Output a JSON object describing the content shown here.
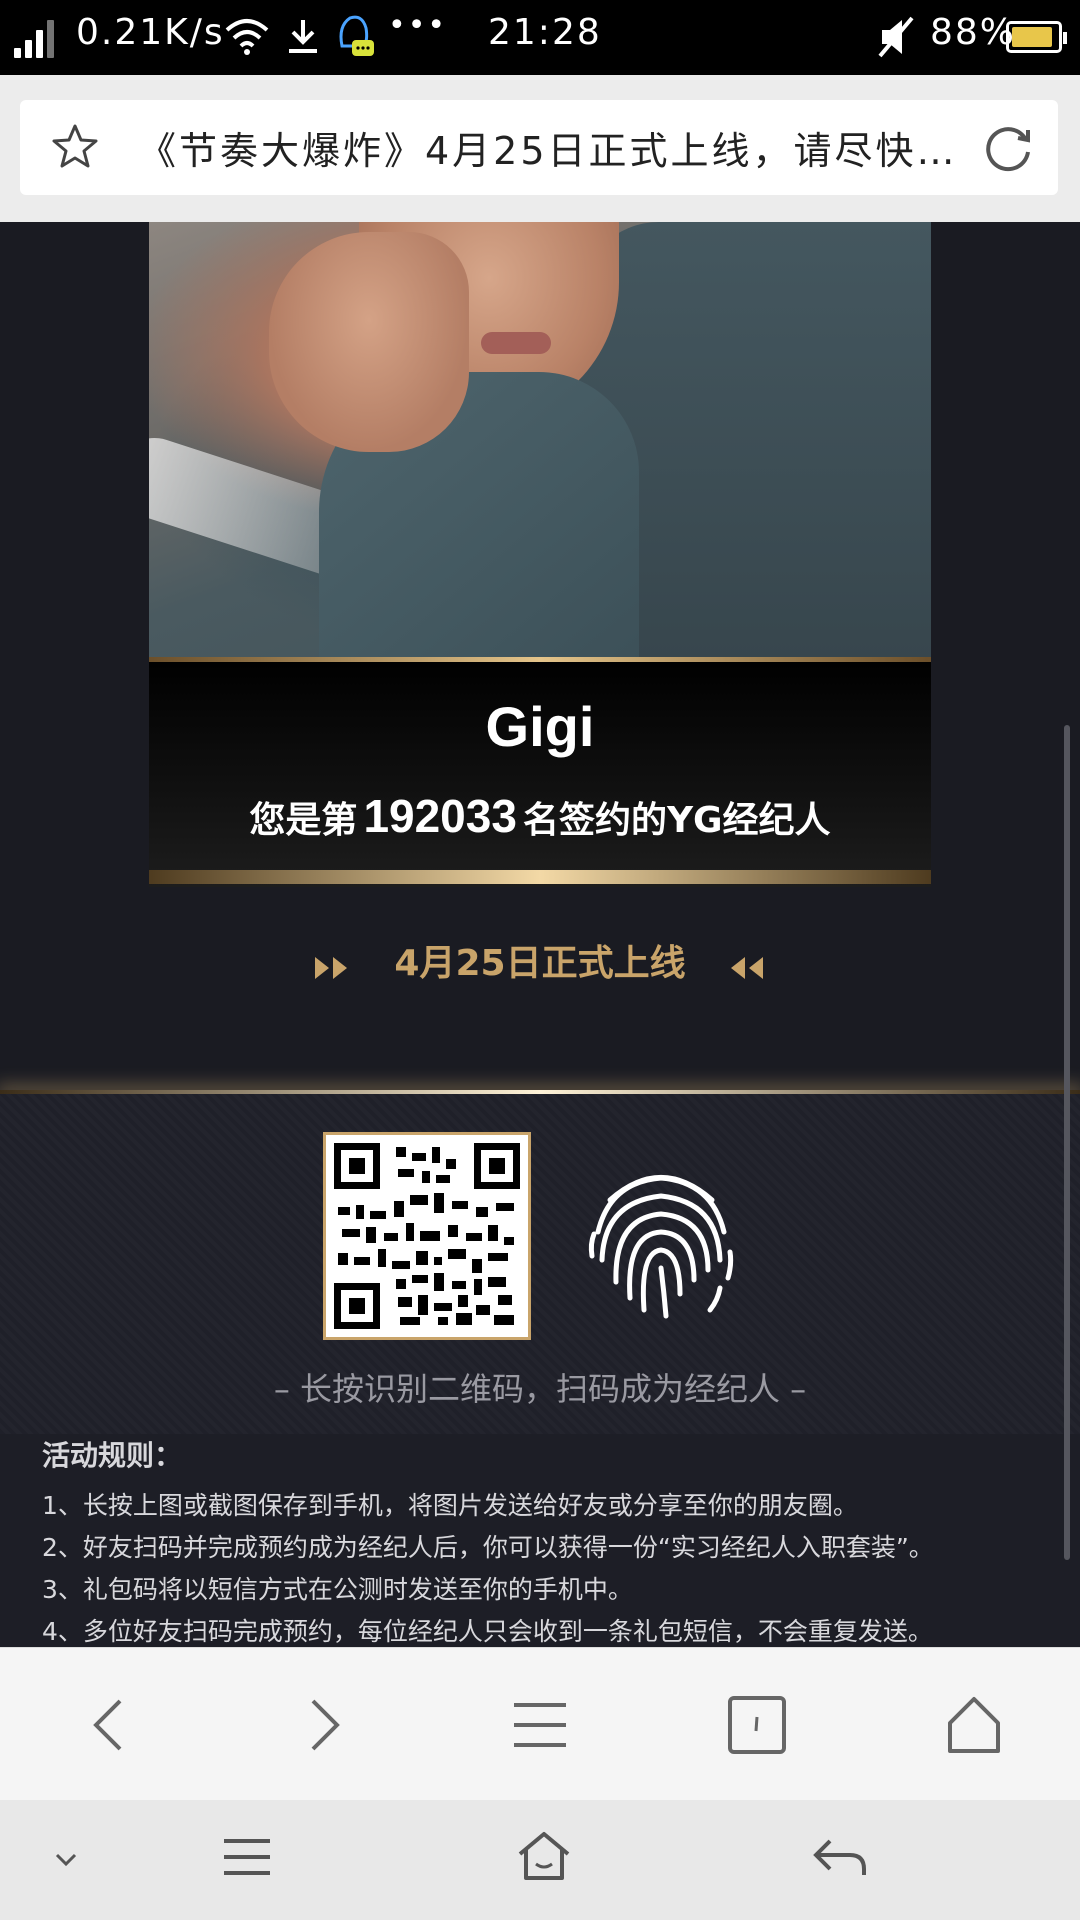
{
  "status_bar": {
    "net_speed": "0.21K/s",
    "time": "21:28",
    "battery": "88%",
    "more": "•••"
  },
  "address_bar": {
    "title": "《节奏大爆炸》4月25日正式上线，请尽快…"
  },
  "card": {
    "name": "Gigi",
    "signed_prefix": "您是第",
    "signed_number": "192033",
    "signed_suffix": "名签约的YG经纪人"
  },
  "launch": {
    "text": "4月25日正式上线"
  },
  "qr": {
    "hint": "– 长按识别二维码，扫码成为经纪人 –"
  },
  "rules": {
    "heading": "活动规则：",
    "items": [
      "1、长按上图或截图保存到手机，将图片发送给好友或分享至你的朋友圈。",
      "2、好友扫码并完成预约成为经纪人后，你可以获得一份“实习经纪人入职套装”。",
      "3、礼包码将以短信方式在公测时发送至你的手机中。",
      "4、多位好友扫码完成预约，每位经纪人只会收到一条礼包短信，不会重复发送。"
    ]
  },
  "colors": {
    "gold": "#c9a46a",
    "background": "#1a1b22"
  },
  "icons": {
    "favorite": "star-icon",
    "reload": "reload-icon",
    "fingerprint": "fingerprint-icon"
  }
}
